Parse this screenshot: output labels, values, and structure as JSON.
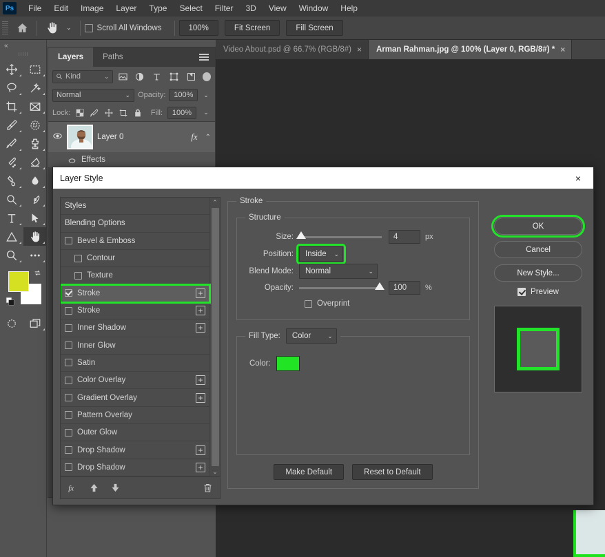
{
  "app": {
    "logo": "Ps",
    "menus": [
      "File",
      "Edit",
      "Image",
      "Layer",
      "Type",
      "Select",
      "Filter",
      "3D",
      "View",
      "Window",
      "Help"
    ]
  },
  "options_bar": {
    "home_icon": "home-icon",
    "tool_icon": "hand-tool-icon",
    "scroll_all_windows": {
      "label": "Scroll All Windows",
      "checked": false
    },
    "zoom_button": "100%",
    "fit_screen_button": "Fit Screen",
    "fill_screen_button": "Fill Screen"
  },
  "toolbar": {
    "collapse": "«",
    "tools": [
      "move-tool-icon",
      "rectangular-marquee-tool-icon",
      "lasso-tool-icon",
      "magic-wand-tool-icon",
      "crop-tool-icon",
      "frame-tool-icon",
      "eyedropper-tool-icon",
      "spot-healing-brush-tool-icon",
      "brush-tool-icon",
      "clone-stamp-tool-icon",
      "history-brush-tool-icon",
      "eraser-tool-icon",
      "gradient-tool-icon",
      "blur-tool-icon",
      "dodge-tool-icon",
      "pen-tool-icon",
      "type-tool-icon",
      "path-selection-tool-icon",
      "shape-tool-icon",
      "hand-tool-icon",
      "zoom-tool-icon",
      "more-tools-icon"
    ],
    "active_tool": "hand-tool-icon",
    "foreground_color": "#d6e022",
    "background_color": "#ffffff",
    "bottom_tools": [
      "quick-mask-icon",
      "screen-mode-icon"
    ]
  },
  "tabs": [
    {
      "label": "Video About.psd @ 66.7% (RGB/8#)",
      "active": false,
      "close": "×"
    },
    {
      "label": "Arman Rahman.jpg @ 100% (Layer 0, RGB/8#) *",
      "active": true,
      "close": "×"
    }
  ],
  "layers_panel": {
    "tabs": [
      {
        "label": "Layers",
        "active": true
      },
      {
        "label": "Paths",
        "active": false
      }
    ],
    "menu_icon": "panel-menu-icon",
    "filter": {
      "kind_label": "Kind",
      "search_icon": "search-icon",
      "icons": [
        "pixel-filter-icon",
        "adjustment-filter-icon",
        "type-filter-icon",
        "shape-filter-icon",
        "smart-object-filter-icon"
      ],
      "toggle": "filter-toggle"
    },
    "blend_mode": "Normal",
    "opacity_label": "Opacity:",
    "opacity_value": "100%",
    "lock_label": "Lock:",
    "lock_icons": [
      "lock-transparent-pixels-icon",
      "lock-image-pixels-icon",
      "lock-position-icon",
      "lock-artboard-icon",
      "lock-all-icon"
    ],
    "fill_label": "Fill:",
    "fill_value": "100%",
    "layer": {
      "visibility_icon": "eye-icon",
      "thumbnail": "layer-thumbnail",
      "name": "Layer 0",
      "fx_badge": "fx",
      "expand_icon": "chevron-up-icon"
    },
    "effects_row": "Effects"
  },
  "dialog": {
    "title": "Layer Style",
    "close": "×",
    "styles": [
      {
        "label": "Styles",
        "type": "header"
      },
      {
        "label": "Blending Options",
        "type": "header"
      },
      {
        "label": "Bevel & Emboss",
        "type": "check",
        "checked": false,
        "indent": false,
        "plus": false
      },
      {
        "label": "Contour",
        "type": "check",
        "checked": false,
        "indent": true,
        "plus": false
      },
      {
        "label": "Texture",
        "type": "check",
        "checked": false,
        "indent": true,
        "plus": false
      },
      {
        "label": "Stroke",
        "type": "check",
        "checked": true,
        "indent": false,
        "plus": true,
        "selected": true,
        "highlight": true
      },
      {
        "label": "Stroke",
        "type": "check",
        "checked": false,
        "indent": false,
        "plus": true
      },
      {
        "label": "Inner Shadow",
        "type": "check",
        "checked": false,
        "indent": false,
        "plus": true
      },
      {
        "label": "Inner Glow",
        "type": "check",
        "checked": false,
        "indent": false,
        "plus": false
      },
      {
        "label": "Satin",
        "type": "check",
        "checked": false,
        "indent": false,
        "plus": false
      },
      {
        "label": "Color Overlay",
        "type": "check",
        "checked": false,
        "indent": false,
        "plus": true
      },
      {
        "label": "Gradient Overlay",
        "type": "check",
        "checked": false,
        "indent": false,
        "plus": true
      },
      {
        "label": "Pattern Overlay",
        "type": "check",
        "checked": false,
        "indent": false,
        "plus": false
      },
      {
        "label": "Outer Glow",
        "type": "check",
        "checked": false,
        "indent": false,
        "plus": false
      },
      {
        "label": "Drop Shadow",
        "type": "check",
        "checked": false,
        "indent": false,
        "plus": true
      },
      {
        "label": "Drop Shadow",
        "type": "check",
        "checked": false,
        "indent": false,
        "plus": true
      }
    ],
    "styles_footer_icons": [
      "fx-icon",
      "move-up-icon",
      "move-down-icon",
      "trash-icon"
    ],
    "stroke": {
      "group_title": "Stroke",
      "structure_title": "Structure",
      "size_label": "Size:",
      "size_value": "4",
      "size_unit": "px",
      "size_slider_pct": 3,
      "position_label": "Position:",
      "position_value": "Inside",
      "position_highlighted": true,
      "blend_mode_label": "Blend Mode:",
      "blend_mode_value": "Normal",
      "opacity_label": "Opacity:",
      "opacity_value": "100",
      "opacity_unit": "%",
      "opacity_slider_pct": 100,
      "overprint_label": "Overprint",
      "overprint_checked": false,
      "fill_type_label": "Fill Type:",
      "fill_type_value": "Color",
      "color_label": "Color:",
      "color_value": "#20e424"
    },
    "make_default": "Make Default",
    "reset_to_default": "Reset to Default",
    "buttons": {
      "ok": "OK",
      "ok_highlighted": true,
      "cancel": "Cancel",
      "new_style": "New Style..."
    },
    "preview": {
      "label": "Preview",
      "checked": true
    },
    "preview_stroke_color": "#22e22a"
  },
  "colors": {
    "highlight_green": "#22e22a",
    "stroke_green": "#20e424",
    "panel_bg": "#535353",
    "canvas_bg": "#2b2b2b"
  }
}
